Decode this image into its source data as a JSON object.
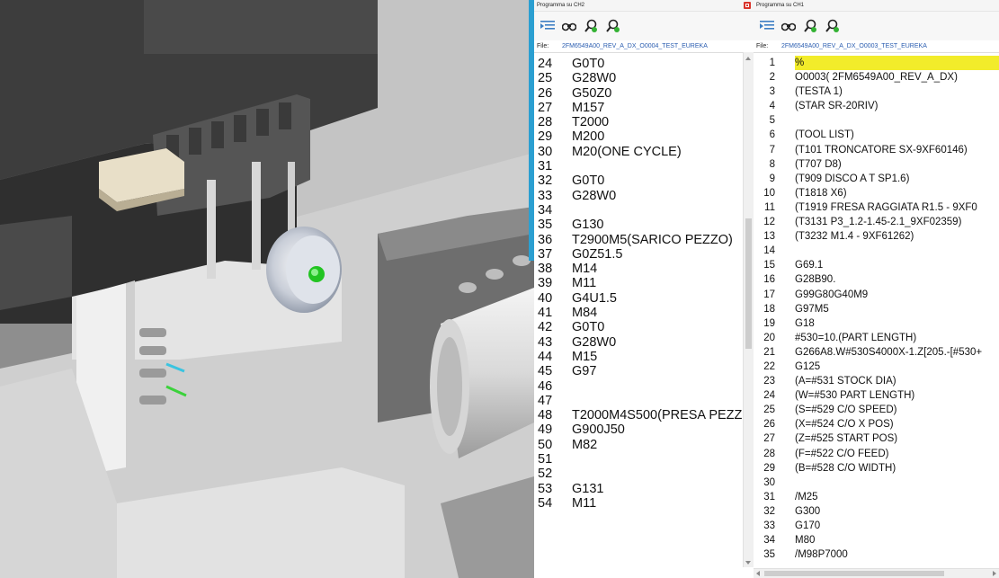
{
  "viewport": {
    "label": ""
  },
  "panel_ch2": {
    "title": "Programma su CH2",
    "file_label": "File:",
    "file_name": "2FM6549A00_REV_A_DX_O0004_TEST_EUREKA",
    "toolbar_icons": [
      "indent-icon",
      "binoculars-icon",
      "search-green-icon",
      "search-green-alt-icon"
    ],
    "lines": [
      {
        "n": "24",
        "t": "G0T0"
      },
      {
        "n": "25",
        "t": "G28W0"
      },
      {
        "n": "26",
        "t": "G50Z0"
      },
      {
        "n": "27",
        "t": "M157"
      },
      {
        "n": "28",
        "t": "T2000"
      },
      {
        "n": "29",
        "t": "M200"
      },
      {
        "n": "30",
        "t": "M20(ONE CYCLE)"
      },
      {
        "n": "31",
        "t": ""
      },
      {
        "n": "32",
        "t": "G0T0"
      },
      {
        "n": "33",
        "t": "G28W0"
      },
      {
        "n": "34",
        "t": ""
      },
      {
        "n": "35",
        "t": "G130"
      },
      {
        "n": "36",
        "t": "T2900M5(SARICO PEZZO)"
      },
      {
        "n": "37",
        "t": "G0Z51.5"
      },
      {
        "n": "38",
        "t": "M14"
      },
      {
        "n": "39",
        "t": "M11"
      },
      {
        "n": "40",
        "t": "G4U1.5"
      },
      {
        "n": "41",
        "t": "M84"
      },
      {
        "n": "42",
        "t": "G0T0"
      },
      {
        "n": "43",
        "t": "G28W0"
      },
      {
        "n": "44",
        "t": "M15"
      },
      {
        "n": "45",
        "t": "G97"
      },
      {
        "n": "46",
        "t": ""
      },
      {
        "n": "47",
        "t": ""
      },
      {
        "n": "48",
        "t": "T2000M4S500(PRESA PEZZ"
      },
      {
        "n": "49",
        "t": "G900J50"
      },
      {
        "n": "50",
        "t": "M82"
      },
      {
        "n": "51",
        "t": ""
      },
      {
        "n": "52",
        "t": ""
      },
      {
        "n": "53",
        "t": "G131"
      },
      {
        "n": "54",
        "t": "M11"
      }
    ]
  },
  "panel_ch1": {
    "title": "Programma su CH1",
    "file_label": "File:",
    "file_name": "2FM6549A00_REV_A_DX_O0003_TEST_EUREKA",
    "toolbar_icons": [
      "indent-icon",
      "binoculars-icon",
      "search-green-icon",
      "search-green-alt-icon"
    ],
    "highlight_color": "#f2ec2a",
    "lines": [
      {
        "n": "1",
        "t": "%"
      },
      {
        "n": "2",
        "t": "O0003( 2FM6549A00_REV_A_DX)"
      },
      {
        "n": "3",
        "t": "(TESTA 1)"
      },
      {
        "n": "4",
        "t": "(STAR SR-20RIV)"
      },
      {
        "n": "5",
        "t": ""
      },
      {
        "n": "6",
        "t": "(TOOL LIST)"
      },
      {
        "n": "7",
        "t": "(T101 TRONCATORE SX-9XF60146)"
      },
      {
        "n": "8",
        "t": "(T707 D8)"
      },
      {
        "n": "9",
        "t": "(T909 DISCO A T SP1.6)"
      },
      {
        "n": "10",
        "t": "(T1818 X6)"
      },
      {
        "n": "11",
        "t": "(T1919 FRESA RAGGIATA R1.5 - 9XF0"
      },
      {
        "n": "12",
        "t": "(T3131 P3_1.2-1.45-2.1_9XF02359)"
      },
      {
        "n": "13",
        "t": "(T3232 M1.4 - 9XF61262)"
      },
      {
        "n": "14",
        "t": ""
      },
      {
        "n": "15",
        "t": "G69.1"
      },
      {
        "n": "16",
        "t": "G28B90."
      },
      {
        "n": "17",
        "t": "G99G80G40M9"
      },
      {
        "n": "18",
        "t": "G97M5"
      },
      {
        "n": "19",
        "t": "G18"
      },
      {
        "n": "20",
        "t": "#530=10.(PART LENGTH)"
      },
      {
        "n": "21",
        "t": "G266A8.W#530S4000X-1.Z[205.-[#530+"
      },
      {
        "n": "22",
        "t": "G125"
      },
      {
        "n": "23",
        "t": "(A=#531 STOCK DIA)"
      },
      {
        "n": "24",
        "t": "(W=#530 PART LENGTH)"
      },
      {
        "n": "25",
        "t": "(S=#529 C/O SPEED)"
      },
      {
        "n": "26",
        "t": "(X=#524 C/O X POS)"
      },
      {
        "n": "27",
        "t": "(Z=#525 START POS)"
      },
      {
        "n": "28",
        "t": "(F=#522 C/O FEED)"
      },
      {
        "n": "29",
        "t": "(B=#528 C/O WIDTH)"
      },
      {
        "n": "30",
        "t": ""
      },
      {
        "n": "31",
        "t": "/M25"
      },
      {
        "n": "32",
        "t": "G300"
      },
      {
        "n": "33",
        "t": "G170"
      },
      {
        "n": "34",
        "t": "M80"
      },
      {
        "n": "35",
        "t": "/M98P7000"
      }
    ]
  }
}
